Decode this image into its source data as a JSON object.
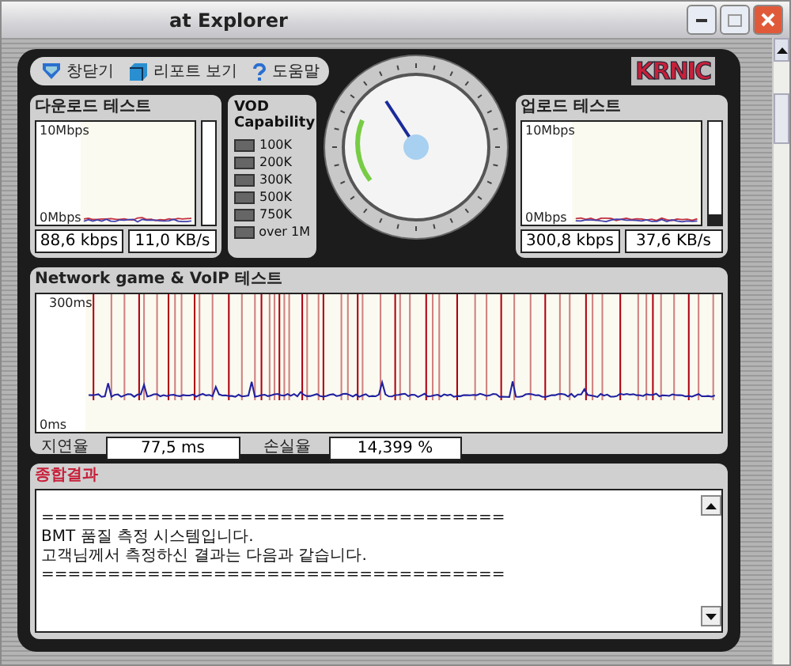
{
  "window": {
    "title": "at Explorer"
  },
  "toolbar": [
    {
      "label": "창닫기",
      "kind": "shield"
    },
    {
      "label": "리포트 보기",
      "kind": "cube"
    },
    {
      "label": "도움말",
      "kind": "help"
    }
  ],
  "logo": "KRNIC",
  "download": {
    "title": "다운로드 테스트",
    "y_max": "10Mbps",
    "y_min": "0Mbps",
    "speed": "88,6 kbps",
    "rate": "11,0 KB/s"
  },
  "vod": {
    "title": "VOD Capability",
    "levels": [
      "100K",
      "200K",
      "300K",
      "500K",
      "750K",
      "over 1M"
    ]
  },
  "upload": {
    "title": "업로드 테스트",
    "y_max": "10Mbps",
    "y_min": "0Mbps",
    "speed": "300,8 kbps",
    "rate": "37,6 KB/s"
  },
  "network": {
    "title": "Network game & VoIP 테스트",
    "y_max": "300ms",
    "y_min": "0ms",
    "latency_label": "지연율",
    "latency": "77,5 ms",
    "loss_label": "손실율",
    "loss": "14,399 %"
  },
  "result": {
    "title": "종합결과",
    "lines": [
      "===================================",
      "BMT 품질 측정 시스템입니다.",
      "고객님께서 측정하신 결과는 다음과 같습니다.",
      "==================================="
    ]
  }
}
